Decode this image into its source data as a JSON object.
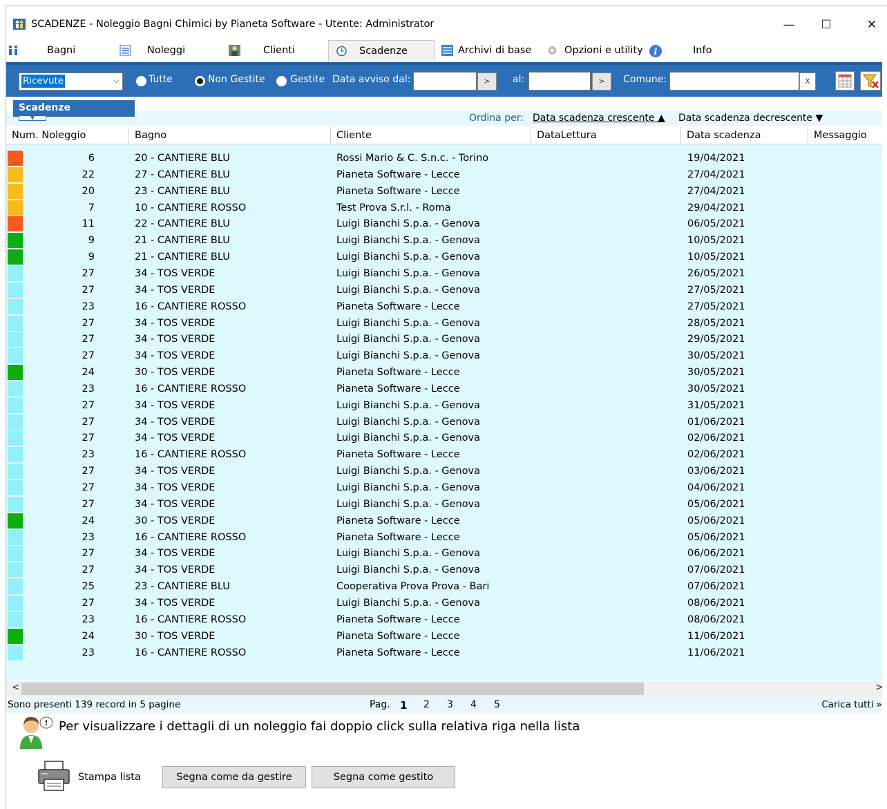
{
  "window": {
    "title": "SCADENZE - Noleggio Bagni Chimici by Pianeta Software - Utente: Administrator",
    "minimize": "—",
    "maximize": "☐",
    "close": "✕"
  },
  "menu": {
    "bagni": "Bagni",
    "noleggi": "Noleggi",
    "clienti": "Clienti",
    "scadenze": "Scadenze",
    "archivi": "Archivi di base",
    "opzioni": "Opzioni e utility",
    "info": "Info"
  },
  "filters": {
    "type_select": "Ricevute",
    "radio_all": "Tutte",
    "radio_not_managed": "Non Gestite",
    "radio_managed": "Gestite",
    "selected_radio": "Non Gestite",
    "date_from_label": "Data avviso dal:",
    "date_from_value": "",
    "date_to_label": "al:",
    "date_to_value": "",
    "go_label": ">",
    "comune_label": "Comune:",
    "comune_value": "",
    "clear_label": "x"
  },
  "section": {
    "title": "Scadenze"
  },
  "sort": {
    "label": "Ordina per:",
    "asc": "Data scadenza crescente ▲",
    "desc": "Data scadenza decrescente ▼",
    "active": "asc"
  },
  "grid": {
    "columns": [
      "Num. Noleggio",
      "Bagno",
      "Cliente",
      "DataLettura",
      "Data scadenza",
      "Messaggio"
    ],
    "status_colors": {
      "red": "#f55a1e",
      "orange": "#f8bb19",
      "green": "#0cb00c",
      "none": "#93f0fb"
    },
    "rows": [
      {
        "status": "red",
        "num": "6",
        "bagno": "20 - CANTIERE BLU",
        "cliente": "Rossi Mario & C. S.n.c. - Torino",
        "lettura": "",
        "scadenza": "19/04/2021",
        "messaggio": ""
      },
      {
        "status": "orange",
        "num": "22",
        "bagno": "27 - CANTIERE BLU",
        "cliente": "Pianeta Software  - Lecce",
        "lettura": "",
        "scadenza": "27/04/2021",
        "messaggio": ""
      },
      {
        "status": "orange",
        "num": "20",
        "bagno": "23 - CANTIERE BLU",
        "cliente": "Pianeta Software  - Lecce",
        "lettura": "",
        "scadenza": "27/04/2021",
        "messaggio": ""
      },
      {
        "status": "orange",
        "num": "7",
        "bagno": "10 - CANTIERE ROSSO",
        "cliente": "Test Prova S.r.l.  - Roma",
        "lettura": "",
        "scadenza": "29/04/2021",
        "messaggio": ""
      },
      {
        "status": "red",
        "num": "11",
        "bagno": "22 - CANTIERE BLU",
        "cliente": "Luigi Bianchi S.p.a.  - Genova",
        "lettura": "",
        "scadenza": "06/05/2021",
        "messaggio": ""
      },
      {
        "status": "green",
        "num": "9",
        "bagno": "21 - CANTIERE BLU",
        "cliente": "Luigi Bianchi S.p.a.  - Genova",
        "lettura": "",
        "scadenza": "10/05/2021",
        "messaggio": ""
      },
      {
        "status": "green",
        "num": "9",
        "bagno": "21 - CANTIERE BLU",
        "cliente": "Luigi Bianchi S.p.a.  - Genova",
        "lettura": "",
        "scadenza": "10/05/2021",
        "messaggio": ""
      },
      {
        "status": "none",
        "num": "27",
        "bagno": "34 - TOS VERDE",
        "cliente": "Luigi Bianchi S.p.a.  - Genova",
        "lettura": "",
        "scadenza": "26/05/2021",
        "messaggio": ""
      },
      {
        "status": "none",
        "num": "27",
        "bagno": "34 - TOS VERDE",
        "cliente": "Luigi Bianchi S.p.a.  - Genova",
        "lettura": "",
        "scadenza": "27/05/2021",
        "messaggio": ""
      },
      {
        "status": "none",
        "num": "23",
        "bagno": "16 - CANTIERE ROSSO",
        "cliente": "Pianeta Software  - Lecce",
        "lettura": "",
        "scadenza": "27/05/2021",
        "messaggio": ""
      },
      {
        "status": "none",
        "num": "27",
        "bagno": "34 - TOS VERDE",
        "cliente": "Luigi Bianchi S.p.a.  - Genova",
        "lettura": "",
        "scadenza": "28/05/2021",
        "messaggio": ""
      },
      {
        "status": "none",
        "num": "27",
        "bagno": "34 - TOS VERDE",
        "cliente": "Luigi Bianchi S.p.a.  - Genova",
        "lettura": "",
        "scadenza": "29/05/2021",
        "messaggio": ""
      },
      {
        "status": "none",
        "num": "27",
        "bagno": "34 - TOS VERDE",
        "cliente": "Luigi Bianchi S.p.a.  - Genova",
        "lettura": "",
        "scadenza": "30/05/2021",
        "messaggio": ""
      },
      {
        "status": "green",
        "num": "24",
        "bagno": "30 - TOS VERDE",
        "cliente": "Pianeta Software  - Lecce",
        "lettura": "",
        "scadenza": "30/05/2021",
        "messaggio": ""
      },
      {
        "status": "none",
        "num": "23",
        "bagno": "16 - CANTIERE ROSSO",
        "cliente": "Pianeta Software  - Lecce",
        "lettura": "",
        "scadenza": "30/05/2021",
        "messaggio": ""
      },
      {
        "status": "none",
        "num": "27",
        "bagno": "34 - TOS VERDE",
        "cliente": "Luigi Bianchi S.p.a.  - Genova",
        "lettura": "",
        "scadenza": "31/05/2021",
        "messaggio": ""
      },
      {
        "status": "none",
        "num": "27",
        "bagno": "34 - TOS VERDE",
        "cliente": "Luigi Bianchi S.p.a.  - Genova",
        "lettura": "",
        "scadenza": "01/06/2021",
        "messaggio": ""
      },
      {
        "status": "none",
        "num": "27",
        "bagno": "34 - TOS VERDE",
        "cliente": "Luigi Bianchi S.p.a.  - Genova",
        "lettura": "",
        "scadenza": "02/06/2021",
        "messaggio": ""
      },
      {
        "status": "none",
        "num": "23",
        "bagno": "16 - CANTIERE ROSSO",
        "cliente": "Pianeta Software  - Lecce",
        "lettura": "",
        "scadenza": "02/06/2021",
        "messaggio": ""
      },
      {
        "status": "none",
        "num": "27",
        "bagno": "34 - TOS VERDE",
        "cliente": "Luigi Bianchi S.p.a.  - Genova",
        "lettura": "",
        "scadenza": "03/06/2021",
        "messaggio": ""
      },
      {
        "status": "none",
        "num": "27",
        "bagno": "34 - TOS VERDE",
        "cliente": "Luigi Bianchi S.p.a.  - Genova",
        "lettura": "",
        "scadenza": "04/06/2021",
        "messaggio": ""
      },
      {
        "status": "none",
        "num": "27",
        "bagno": "34 - TOS VERDE",
        "cliente": "Luigi Bianchi S.p.a.  - Genova",
        "lettura": "",
        "scadenza": "05/06/2021",
        "messaggio": ""
      },
      {
        "status": "green",
        "num": "24",
        "bagno": "30 - TOS VERDE",
        "cliente": "Pianeta Software  - Lecce",
        "lettura": "",
        "scadenza": "05/06/2021",
        "messaggio": ""
      },
      {
        "status": "none",
        "num": "23",
        "bagno": "16 - CANTIERE ROSSO",
        "cliente": "Pianeta Software  - Lecce",
        "lettura": "",
        "scadenza": "05/06/2021",
        "messaggio": ""
      },
      {
        "status": "none",
        "num": "27",
        "bagno": "34 - TOS VERDE",
        "cliente": "Luigi Bianchi S.p.a.  - Genova",
        "lettura": "",
        "scadenza": "06/06/2021",
        "messaggio": ""
      },
      {
        "status": "none",
        "num": "27",
        "bagno": "34 - TOS VERDE",
        "cliente": "Luigi Bianchi S.p.a.  - Genova",
        "lettura": "",
        "scadenza": "07/06/2021",
        "messaggio": ""
      },
      {
        "status": "none",
        "num": "25",
        "bagno": "23 - CANTIERE BLU",
        "cliente": "Cooperativa Prova Prova  - Bari",
        "lettura": "",
        "scadenza": "07/06/2021",
        "messaggio": ""
      },
      {
        "status": "none",
        "num": "27",
        "bagno": "34 - TOS VERDE",
        "cliente": "Luigi Bianchi S.p.a.  - Genova",
        "lettura": "",
        "scadenza": "08/06/2021",
        "messaggio": ""
      },
      {
        "status": "none",
        "num": "23",
        "bagno": "16 - CANTIERE ROSSO",
        "cliente": "Pianeta Software  - Lecce",
        "lettura": "",
        "scadenza": "08/06/2021",
        "messaggio": ""
      },
      {
        "status": "green",
        "num": "24",
        "bagno": "30 - TOS VERDE",
        "cliente": "Pianeta Software  - Lecce",
        "lettura": "",
        "scadenza": "11/06/2021",
        "messaggio": ""
      },
      {
        "status": "none",
        "num": "23",
        "bagno": "16 - CANTIERE ROSSO",
        "cliente": "Pianeta Software  - Lecce",
        "lettura": "",
        "scadenza": "11/06/2021",
        "messaggio": ""
      }
    ]
  },
  "scroll": {
    "left": "<",
    "right": ">"
  },
  "pager": {
    "records_text": "Sono presenti 139 record in 5 pagine",
    "page_label": "Pag.",
    "pages": [
      "1",
      "2",
      "3",
      "4",
      "5"
    ],
    "current_page": "1",
    "load_all": "Carica tutti »"
  },
  "hint": {
    "text": "Per visualizzare i dettagli di un noleggio fai doppio click sulla relativa riga nella lista"
  },
  "actions": {
    "print": "Stampa lista",
    "mark_to_manage": "Segna come da gestire",
    "mark_managed": "Segna come gestito"
  }
}
